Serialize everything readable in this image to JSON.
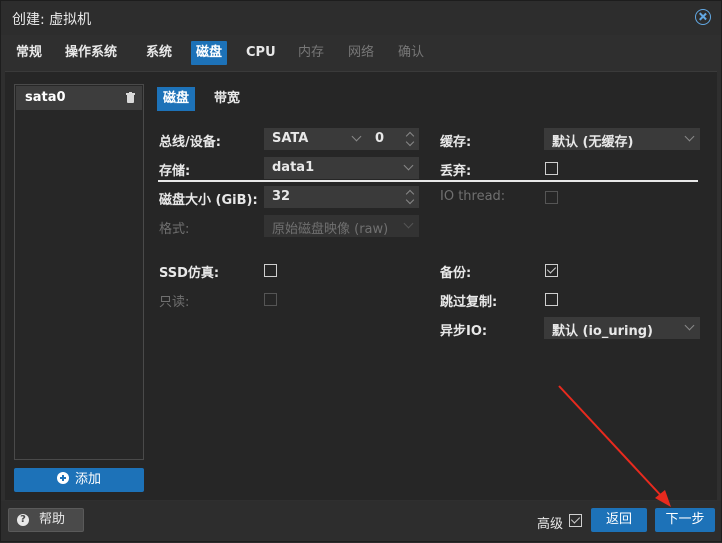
{
  "window": {
    "title": "创建: 虚拟机"
  },
  "tabs": [
    {
      "label": "常规",
      "state": "normal"
    },
    {
      "label": "操作系统",
      "state": "normal"
    },
    {
      "label": "系统",
      "state": "normal"
    },
    {
      "label": "磁盘",
      "state": "active"
    },
    {
      "label": "CPU",
      "state": "normal"
    },
    {
      "label": "内存",
      "state": "disabled"
    },
    {
      "label": "网络",
      "state": "disabled"
    },
    {
      "label": "确认",
      "state": "disabled"
    }
  ],
  "disks": {
    "items": [
      {
        "label": "sata0"
      }
    ],
    "add_label": "添加"
  },
  "subtabs": [
    {
      "label": "磁盘",
      "state": "active"
    },
    {
      "label": "带宽",
      "state": "normal"
    }
  ],
  "form": {
    "bus_label": "总线/设备:",
    "bus_value": "SATA",
    "device_value": "0",
    "storage_label": "存储:",
    "storage_value": "data1",
    "size_label": "磁盘大小 (GiB):",
    "size_value": "32",
    "format_label": "格式:",
    "format_value": "原始磁盘映像 (raw)",
    "cache_label": "缓存:",
    "cache_value": "默认 (无缓存)",
    "discard_label": "丢弃:",
    "discard_checked": false,
    "iothread_label": "IO thread:",
    "iothread_checked": false,
    "ssd_label": "SSD仿真:",
    "ssd_checked": false,
    "readonly_label": "只读:",
    "readonly_checked": false,
    "backup_label": "备份:",
    "backup_checked": true,
    "skip_replication_label": "跳过复制:",
    "skip_replication_checked": false,
    "async_io_label": "异步IO:",
    "async_io_value": "默认 (io_uring)"
  },
  "footer": {
    "help_label": "帮助",
    "advanced_label": "高级",
    "advanced_checked": true,
    "back_label": "返回",
    "next_label": "下一步"
  },
  "colors": {
    "accent": "#1d72b8",
    "annotation_arrow": "#e82a1e"
  }
}
